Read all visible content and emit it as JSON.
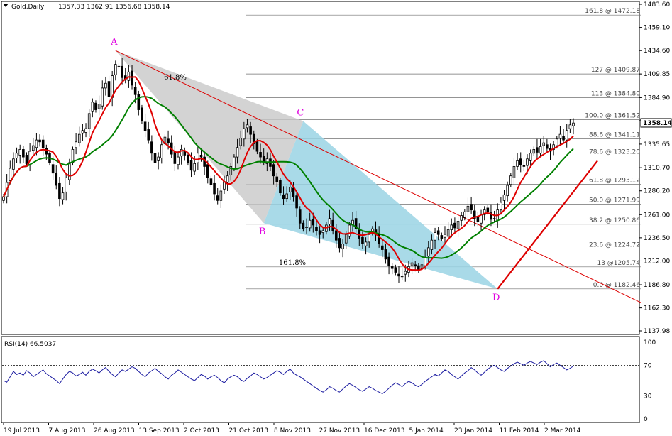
{
  "header": {
    "symbol": "Gold,Daily",
    "ohlc": "1357.33 1362.91 1356.68 1358.14"
  },
  "rsi": {
    "label": "RSI(14) 66.5037",
    "levels": [
      70,
      30
    ],
    "axis": [
      "100",
      "70",
      "30",
      "0"
    ],
    "values": [
      50,
      48,
      55,
      62,
      58,
      60,
      57,
      63,
      60,
      55,
      58,
      61,
      64,
      59,
      56,
      53,
      50,
      46,
      52,
      58,
      62,
      60,
      56,
      58,
      61,
      57,
      62,
      65,
      63,
      60,
      64,
      67,
      62,
      58,
      55,
      60,
      64,
      62,
      65,
      68,
      66,
      62,
      58,
      55,
      60,
      63,
      66,
      62,
      59,
      55,
      52,
      57,
      60,
      64,
      61,
      58,
      55,
      52,
      50,
      54,
      58,
      56,
      52,
      55,
      57,
      54,
      50,
      47,
      52,
      55,
      57,
      55,
      51,
      49,
      53,
      56,
      60,
      58,
      55,
      52,
      54,
      57,
      60,
      63,
      61,
      58,
      62,
      65,
      60,
      57,
      55,
      52,
      49,
      46,
      43,
      40,
      37,
      35,
      38,
      42,
      40,
      37,
      35,
      39,
      43,
      46,
      44,
      41,
      38,
      36,
      39,
      42,
      40,
      37,
      35,
      33,
      36,
      40,
      44,
      47,
      45,
      42,
      46,
      49,
      47,
      44,
      42,
      45,
      49,
      52,
      55,
      58,
      56,
      60,
      64,
      62,
      58,
      55,
      52,
      56,
      60,
      63,
      67,
      64,
      60,
      57,
      61,
      65,
      68,
      70,
      67,
      64,
      62,
      66,
      69,
      72,
      74,
      72,
      70,
      73,
      75,
      73,
      71,
      74,
      76,
      72,
      68,
      71,
      73,
      70,
      67,
      64,
      66,
      69
    ],
    "color": "#1a1aa0"
  },
  "chart_data": {
    "type": "candlestick",
    "symbol": "Gold,Daily",
    "last_price": "1358.14",
    "ylim": [
      1137.98,
      1483.6
    ],
    "y_ticks": [
      "1483.60",
      "1459.10",
      "1434.60",
      "1409.85",
      "1384.90",
      "1360.40",
      "1335.65",
      "1310.70",
      "1286.20",
      "1261.00",
      "1236.50",
      "1212.00",
      "1186.80",
      "1162.30",
      "1137.98"
    ],
    "x_ticks": [
      "19 Jul 2013",
      "7 Aug 2013",
      "26 Aug 2013",
      "13 Sep 2013",
      "2 Oct 2013",
      "21 Oct 2013",
      "8 Nov 2013",
      "27 Nov 2013",
      "16 Dec 2013",
      "5 Jan 2014",
      "23 Jan 2014",
      "11 Feb 2014",
      "2 Mar 2014"
    ],
    "closes": [
      1280,
      1295,
      1310,
      1320,
      1326,
      1330,
      1322,
      1315,
      1328,
      1334,
      1340,
      1338,
      1332,
      1325,
      1316,
      1305,
      1292,
      1278,
      1284,
      1300,
      1316,
      1330,
      1338,
      1346,
      1350,
      1352,
      1368,
      1380,
      1372,
      1378,
      1395,
      1400,
      1386,
      1408,
      1420,
      1418,
      1406,
      1404,
      1412,
      1398,
      1388,
      1372,
      1360,
      1350,
      1340,
      1326,
      1316,
      1322,
      1335,
      1343,
      1337,
      1325,
      1315,
      1322,
      1330,
      1324,
      1316,
      1308,
      1315,
      1326,
      1322,
      1312,
      1300,
      1293,
      1283,
      1276,
      1286,
      1296,
      1302,
      1312,
      1322,
      1332,
      1342,
      1352,
      1356,
      1346,
      1336,
      1328,
      1322,
      1317,
      1320,
      1312,
      1302,
      1296,
      1284,
      1278,
      1283,
      1290,
      1280,
      1268,
      1252,
      1246,
      1248,
      1255,
      1250,
      1244,
      1240,
      1244,
      1250,
      1257,
      1244,
      1234,
      1226,
      1230,
      1240,
      1250,
      1255,
      1246,
      1236,
      1230,
      1232,
      1240,
      1246,
      1240,
      1230,
      1224,
      1214,
      1207,
      1204,
      1200,
      1196,
      1196,
      1201,
      1206,
      1210,
      1207,
      1202,
      1208,
      1216,
      1226,
      1234,
      1242,
      1240,
      1236,
      1240,
      1245,
      1250,
      1247,
      1254,
      1260,
      1264,
      1270,
      1266,
      1257,
      1254,
      1261,
      1266,
      1264,
      1256,
      1257,
      1266,
      1274,
      1282,
      1292,
      1302,
      1312,
      1318,
      1314,
      1312,
      1320,
      1326,
      1330,
      1327,
      1333,
      1337,
      1331,
      1328,
      1335,
      1341,
      1346,
      1340,
      1350,
      1356,
      1358
    ],
    "fibonacci": [
      {
        "label": "161.8 @ 1472.18",
        "value": 1472.18
      },
      {
        "label": "127 @ 1409.87",
        "value": 1409.87
      },
      {
        "label": "113 @ 1384.80",
        "value": 1384.8
      },
      {
        "label": "100.0 @ 1361.52",
        "value": 1361.52
      },
      {
        "label": "88.6 @ 1341.11",
        "value": 1341.11
      },
      {
        "label": "78.6 @ 1323.20",
        "value": 1323.2
      },
      {
        "label": "61.8 @ 1293.12",
        "value": 1293.12
      },
      {
        "label": "50.0 @ 1271.99",
        "value": 1271.99
      },
      {
        "label": "38.2 @ 1250.86",
        "value": 1250.86
      },
      {
        "label": "23.6 @ 1224.72",
        "value": 1224.72
      },
      {
        "label": "13 @1205.74",
        "value": 1205.74
      },
      {
        "label": "0.0 @ 1182.46",
        "value": 1182.46
      }
    ],
    "harmonic_points": [
      {
        "label": "A",
        "bar": 34,
        "price": 1434.6
      },
      {
        "label": "B",
        "bar": 79,
        "price": 1252.0
      },
      {
        "label": "C",
        "bar": 91,
        "price": 1360.0
      },
      {
        "label": "D",
        "bar": 150,
        "price": 1182.46
      }
    ],
    "ratios": [
      {
        "label": "61.8%"
      },
      {
        "label": "161.8%"
      }
    ],
    "colors": {
      "candle": "#000000",
      "fast_ma": "#e00000",
      "slow_ma": "#008000",
      "triangle_abc": "#c8c8c8",
      "triangle_bcd": "#9ad3e4",
      "downtrend": "#dd0000",
      "uptrend": "#dd0000",
      "point_labels": "#e000e0",
      "fib_lines": "#707070"
    }
  }
}
